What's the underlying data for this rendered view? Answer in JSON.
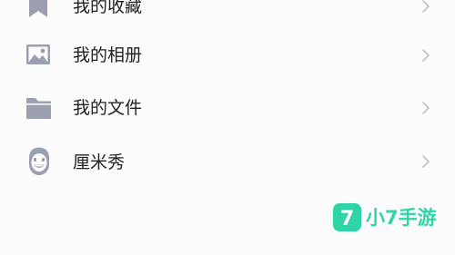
{
  "menu": {
    "items": [
      {
        "label": "我的收藏",
        "icon": "bookmark-icon"
      },
      {
        "label": "我的相册",
        "icon": "photo-album-icon"
      },
      {
        "label": "我的文件",
        "icon": "folder-icon"
      },
      {
        "label": "厘米秀",
        "icon": "avatar-face-icon"
      }
    ],
    "chevron_icon": "chevron-right-icon"
  },
  "watermark": {
    "logo_text": "7",
    "text": "小7手游"
  },
  "colors": {
    "icon": "#9a9fb2",
    "chevron": "#c2c2c2",
    "label": "#222222",
    "watermark": "#2fd5a6",
    "background": "#fcfcfc"
  }
}
